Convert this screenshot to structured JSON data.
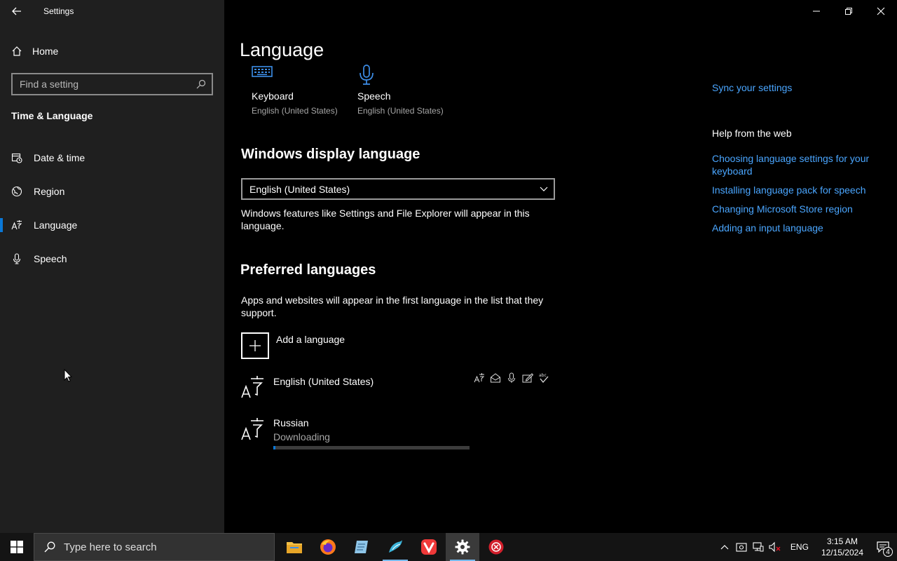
{
  "window": {
    "title": "Settings"
  },
  "sidebar": {
    "home_label": "Home",
    "search_placeholder": "Find a setting",
    "section_title": "Time & Language",
    "items": [
      {
        "label": "Date & time"
      },
      {
        "label": "Region"
      },
      {
        "label": "Language"
      },
      {
        "label": "Speech"
      }
    ],
    "active_item": "Language"
  },
  "main": {
    "title": "Language",
    "tiles": [
      {
        "label": "Keyboard",
        "sub": "English (United States)"
      },
      {
        "label": "Speech",
        "sub": "English (United States)"
      }
    ],
    "display_language": {
      "heading": "Windows display language",
      "selected": "English (United States)",
      "description": "Windows features like Settings and File Explorer will appear in this language."
    },
    "preferred": {
      "heading": "Preferred languages",
      "description": "Apps and websites will appear in the first language in the list that they support.",
      "add_label": "Add a language",
      "languages": [
        {
          "name": "English (United States)",
          "status": ""
        },
        {
          "name": "Russian",
          "status": "Downloading",
          "progress": 0.01
        }
      ]
    }
  },
  "right": {
    "sync_link": "Sync your settings",
    "help_heading": "Help from the web",
    "help_links": [
      "Choosing language settings for your keyboard",
      "Installing language pack for speech",
      "Changing Microsoft Store region",
      "Adding an input language"
    ]
  },
  "taskbar": {
    "search_placeholder": "Type here to search",
    "language": "ENG",
    "time": "3:15 AM",
    "date": "12/15/2024",
    "notification_count": "4"
  },
  "colors": {
    "accent": "#0a78d7",
    "link": "#4aa6ff"
  }
}
